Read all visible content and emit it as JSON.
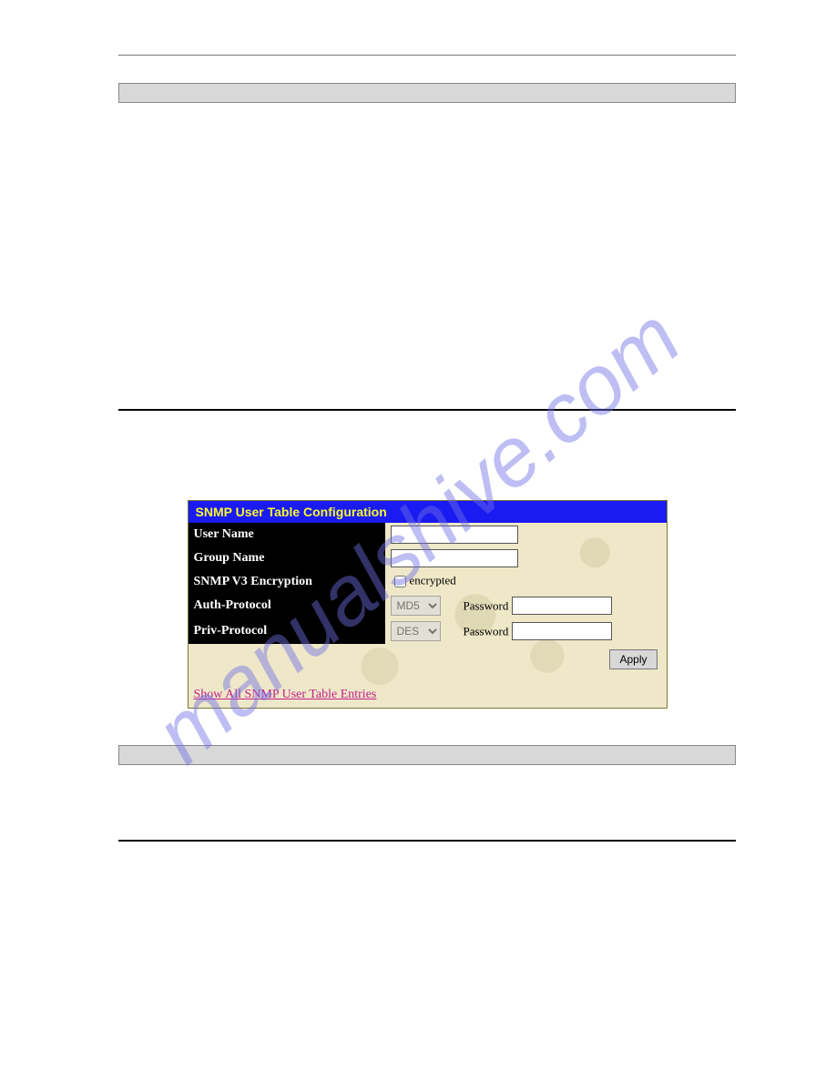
{
  "watermark": "manualshive.com",
  "panel": {
    "title": "SNMP User Table Configuration",
    "rows": {
      "user_name_label": "User Name",
      "group_name_label": "Group Name",
      "v3_encryption_label": "SNMP V3 Encryption",
      "encrypted_label": "encrypted",
      "auth_protocol_label": "Auth-Protocol",
      "priv_protocol_label": "Priv-Protocol",
      "password_label": "Password"
    },
    "selects": {
      "auth_value": "MD5",
      "priv_value": "DES"
    },
    "apply_label": "Apply",
    "link_label": "Show All SNMP User Table Entries"
  }
}
